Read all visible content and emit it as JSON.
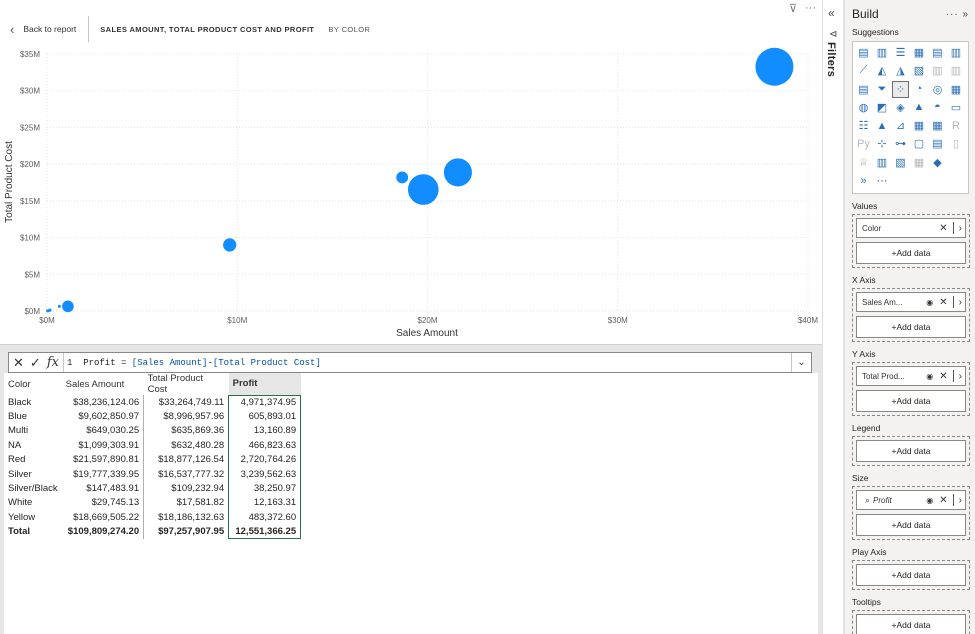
{
  "report": {
    "back_label": "Back to report",
    "title": "SALES AMOUNT, TOTAL PRODUCT COST AND PROFIT",
    "subtitle": "BY COLOR"
  },
  "chart_data": {
    "type": "scatter",
    "xlabel": "Sales Amount",
    "ylabel": "Total Product Cost",
    "x_ticks": [
      "$0M",
      "$10M",
      "$20M",
      "$30M",
      "$40M"
    ],
    "y_ticks": [
      "$0M",
      "$5M",
      "$10M",
      "$15M",
      "$20M",
      "$25M",
      "$30M",
      "$35M"
    ],
    "xlim": [
      0,
      40000000
    ],
    "ylim": [
      0,
      35000000
    ],
    "grid": true,
    "bubble_color": "#118DFF",
    "size_field": "Profit",
    "points": [
      {
        "label": "Black",
        "x": 38236124.06,
        "y": 33264749.11,
        "size": 4971374.95
      },
      {
        "label": "Blue",
        "x": 9602850.97,
        "y": 8996957.96,
        "size": 605893.01
      },
      {
        "label": "Multi",
        "x": 649030.25,
        "y": 635869.36,
        "size": 13160.89
      },
      {
        "label": "NA",
        "x": 1099303.91,
        "y": 632480.28,
        "size": 466823.63
      },
      {
        "label": "Red",
        "x": 21597890.81,
        "y": 18877126.54,
        "size": 2720764.26
      },
      {
        "label": "Silver",
        "x": 19777339.95,
        "y": 16537777.32,
        "size": 3239562.63
      },
      {
        "label": "Silver/Black",
        "x": 147483.91,
        "y": 109232.94,
        "size": 38250.97
      },
      {
        "label": "White",
        "x": 29745.13,
        "y": 17581.82,
        "size": 12163.31
      },
      {
        "label": "Yellow",
        "x": 18669505.22,
        "y": 18186132.63,
        "size": 483372.6
      }
    ]
  },
  "formula": {
    "line_no": "1",
    "measure": "Profit",
    "op": " = ",
    "ref1": "[Sales Amount]",
    "minus": "-",
    "ref2": "[Total Product Cost]"
  },
  "table": {
    "headers": [
      "Color",
      "Sales Amount",
      "Total Product Cost",
      "Profit"
    ],
    "rows": [
      [
        "Black",
        "$38,236,124.06",
        "$33,264,749.11",
        "4,971,374.95"
      ],
      [
        "Blue",
        "$9,602,850.97",
        "$8,996,957.96",
        "605,893.01"
      ],
      [
        "Multi",
        "$649,030.25",
        "$635,869.36",
        "13,160.89"
      ],
      [
        "NA",
        "$1,099,303.91",
        "$632,480.28",
        "466,823.63"
      ],
      [
        "Red",
        "$21,597,890.81",
        "$18,877,126.54",
        "2,720,764.26"
      ],
      [
        "Silver",
        "$19,777,339.95",
        "$16,537,777.32",
        "3,239,562.63"
      ],
      [
        "Silver/Black",
        "$147,483.91",
        "$109,232.94",
        "38,250.97"
      ],
      [
        "White",
        "$29,745.13",
        "$17,581.82",
        "12,163.31"
      ],
      [
        "Yellow",
        "$18,669,505.22",
        "$18,186,132.63",
        "483,372.60"
      ]
    ],
    "total": [
      "Total",
      "$109,809,274.20",
      "$97,257,907.95",
      "12,551,366.25"
    ]
  },
  "filters": {
    "label": "Filters"
  },
  "build": {
    "title": "Build",
    "suggestions_label": "Suggestions",
    "add_data": "+Add data",
    "wells": {
      "values": {
        "label": "Values",
        "field": "Color"
      },
      "x_axis": {
        "label": "X Axis",
        "field": "Sales Am..."
      },
      "y_axis": {
        "label": "Y Axis",
        "field": "Total Prod..."
      },
      "legend": {
        "label": "Legend"
      },
      "size": {
        "label": "Size",
        "field": "Profit"
      },
      "play_axis": {
        "label": "Play Axis"
      },
      "tooltips": {
        "label": "Tooltips"
      }
    }
  }
}
